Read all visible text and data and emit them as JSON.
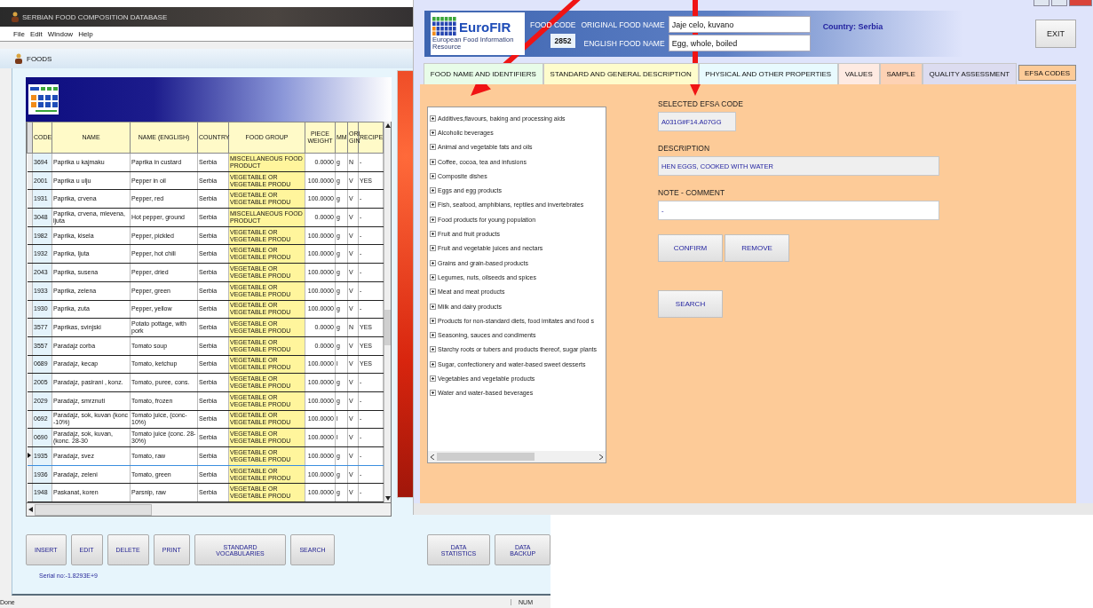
{
  "main_window": {
    "title": "SERBIAN FOOD COMPOSITION DATABASE",
    "menu": [
      "File",
      "Edit",
      "Window",
      "Help"
    ],
    "child_window": {
      "title": "FOODS"
    },
    "table": {
      "columns": [
        "CODE",
        "NAME",
        "NAME (ENGLISH)",
        "COUNTRY",
        "FOOD GROUP",
        "PIECE WEIGHT",
        "MM",
        "ORI GIN",
        "RECIPE"
      ],
      "rows": [
        {
          "selected": false,
          "cells": [
            "3694",
            "Paprika u kajmaku",
            "Paprika in custard",
            "Serbia",
            "MISCELLANEOUS FOOD PRODUCT",
            "0.0000",
            "g",
            "N",
            "-"
          ]
        },
        {
          "selected": false,
          "cells": [
            "2001",
            "Paprika u ulju",
            "Pepper in oil",
            "Serbia",
            "VEGETABLE OR VEGETABLE PRODU",
            "100.0000",
            "g",
            "V",
            "YES"
          ]
        },
        {
          "selected": false,
          "cells": [
            "1931",
            "Paprika, crvena",
            "Pepper, red",
            "Serbia",
            "VEGETABLE OR VEGETABLE PRODU",
            "100.0000",
            "g",
            "V",
            "-"
          ]
        },
        {
          "selected": false,
          "cells": [
            "3048",
            "Paprika, crvena, mlevena, ljuta",
            "Hot pepper, ground",
            "Serbia",
            "MISCELLANEOUS FOOD PRODUCT",
            "0.0000",
            "g",
            "V",
            "-"
          ]
        },
        {
          "selected": false,
          "cells": [
            "1982",
            "Paprika, kisela",
            "Pepper, pickled",
            "Serbia",
            "VEGETABLE OR VEGETABLE PRODU",
            "100.0000",
            "g",
            "V",
            "-"
          ]
        },
        {
          "selected": false,
          "cells": [
            "1932",
            "Paprika, ljuta",
            "Pepper, hot chili",
            "Serbia",
            "VEGETABLE OR VEGETABLE PRODU",
            "100.0000",
            "g",
            "V",
            "-"
          ]
        },
        {
          "selected": false,
          "cells": [
            "2043",
            "Paprika, susena",
            "Pepper, dried",
            "Serbia",
            "VEGETABLE OR VEGETABLE PRODU",
            "100.0000",
            "g",
            "V",
            "-"
          ]
        },
        {
          "selected": false,
          "cells": [
            "1933",
            "Paprika, zelena",
            "Pepper, green",
            "Serbia",
            "VEGETABLE OR VEGETABLE PRODU",
            "100.0000",
            "g",
            "V",
            "-"
          ]
        },
        {
          "selected": false,
          "cells": [
            "1930",
            "Paprika, zuta",
            "Pepper, yellow",
            "Serbia",
            "VEGETABLE OR VEGETABLE PRODU",
            "100.0000",
            "g",
            "V",
            "-"
          ]
        },
        {
          "selected": false,
          "cells": [
            "3577",
            "Paprikas, svinjski",
            "Potato pottage, with pork",
            "Serbia",
            "VEGETABLE OR VEGETABLE PRODU",
            "0.0000",
            "g",
            "N",
            "YES"
          ]
        },
        {
          "selected": false,
          "cells": [
            "3557",
            "Paradajz corba",
            "Tomato soup",
            "Serbia",
            "VEGETABLE OR VEGETABLE PRODU",
            "0.0000",
            "g",
            "V",
            "YES"
          ]
        },
        {
          "selected": false,
          "cells": [
            "0689",
            "Paradajz, kecap",
            "Tomato, ketchup",
            "Serbia",
            "VEGETABLE OR VEGETABLE PRODU",
            "100.0000",
            "l",
            "V",
            "YES"
          ]
        },
        {
          "selected": false,
          "cells": [
            "2005",
            "Paradajz, pasirani , konz.",
            "Tomato, puree, cons.",
            "Serbia",
            "VEGETABLE OR VEGETABLE PRODU",
            "100.0000",
            "g",
            "V",
            "-"
          ]
        },
        {
          "selected": false,
          "cells": [
            "2029",
            "Paradajz, smrznuti",
            "Tomato, frozen",
            "Serbia",
            "VEGETABLE OR VEGETABLE PRODU",
            "100.0000",
            "g",
            "V",
            "-"
          ]
        },
        {
          "selected": false,
          "cells": [
            "0692",
            "Paradajz, sok, kuvan (konc -10%)",
            "Tomato juice, (conc-10%)",
            "Serbia",
            "VEGETABLE OR VEGETABLE PRODU",
            "100.0000",
            "l",
            "V",
            "-"
          ]
        },
        {
          "selected": false,
          "cells": [
            "0690",
            "Paradajz, sok, kuvan, (konc. 28-30",
            "Tomato juice (conc. 28-30%)",
            "Serbia",
            "VEGETABLE OR VEGETABLE PRODU",
            "100.0000",
            "l",
            "V",
            "-"
          ]
        },
        {
          "selected": true,
          "cells": [
            "1935",
            "Paradajz, svez",
            "Tomato, raw",
            "Serbia",
            "VEGETABLE OR VEGETABLE PRODU",
            "100.0000",
            "g",
            "V",
            "-"
          ]
        },
        {
          "selected": false,
          "cells": [
            "1936",
            "Paradajz, zeleni",
            "Tomato, green",
            "Serbia",
            "VEGETABLE OR VEGETABLE PRODU",
            "100.0000",
            "g",
            "V",
            "-"
          ]
        },
        {
          "selected": false,
          "cells": [
            "1948",
            "Paskanat, koren",
            "Parsnip, raw",
            "Serbia",
            "VEGETABLE OR VEGETABLE PRODU",
            "100.0000",
            "g",
            "V",
            "-"
          ]
        }
      ]
    },
    "buttons": [
      "INSERT",
      "EDIT",
      "DELETE",
      "PRINT",
      "STANDARD VOCABULARIES",
      "SEARCH"
    ],
    "side_buttons": [
      "DATA STATISTICS",
      "DATA BACKUP"
    ],
    "serial": "Serial no:-1.8293E+9",
    "status_bar": {
      "text": "Done",
      "indicator": "NUM"
    }
  },
  "properties_window": {
    "logo": {
      "name": "EuroFIR",
      "tagline": "European Food Information Resource"
    },
    "food_code_label": "FOOD CODE",
    "food_code": "2852",
    "original_name_label": "ORIGINAL FOOD NAME",
    "original_name": "Jaje celo, kuvano",
    "english_name_label": "ENGLISH FOOD NAME",
    "english_name": "Egg, whole, boiled",
    "country": "Country: Serbia",
    "exit": "EXIT",
    "tabs": [
      {
        "label": "FOOD NAME AND IDENTIFIERS",
        "color": "#e8fce8",
        "selected": false
      },
      {
        "label": "STANDARD AND GENERAL  DESCRIPTION",
        "color": "#fefccc",
        "selected": false
      },
      {
        "label": "PHYSICAL AND OTHER PROPERTIES",
        "color": "#e8fafe",
        "selected": false
      },
      {
        "label": "VALUES",
        "color": "#feeae2",
        "selected": false
      },
      {
        "label": "SAMPLE",
        "color": "#fdd2b4",
        "selected": false
      },
      {
        "label": "QUALITY ASSESSMENT",
        "color": "#dcdcf0",
        "selected": false
      },
      {
        "label": "EFSA CODES",
        "color": "#fdcb98",
        "selected": true
      }
    ],
    "tree": [
      {
        "label": "Additives,flavours, baking and processing aids",
        "expanded": false
      },
      {
        "label": "Alcoholic beverages",
        "expanded": false
      },
      {
        "label": "Animal and vegetable fats and oils",
        "expanded": false
      },
      {
        "label": "Coffee, cocoa, tea and infusions",
        "expanded": false
      },
      {
        "label": "Composite dishes",
        "expanded": false
      },
      {
        "label": "Eggs and egg products",
        "expanded": false
      },
      {
        "label": "Fish, seafood, amphibians, reptiles and invertebrates",
        "expanded": false
      },
      {
        "label": "Food products for young population",
        "expanded": false
      },
      {
        "label": "Fruit and fruit products",
        "expanded": false
      },
      {
        "label": "Fruit and vegetable juices and nectars",
        "expanded": false
      },
      {
        "label": "Grains and grain-based products",
        "expanded": false
      },
      {
        "label": "Legumes, nuts, oilseeds and spices",
        "expanded": false
      },
      {
        "label": "Meat and meat products",
        "expanded": false
      },
      {
        "label": "Milk and dairy products",
        "expanded": false
      },
      {
        "label": "Products for non-standard diets, food imitates and food s",
        "expanded": false
      },
      {
        "label": "Seasoning, sauces and condiments",
        "expanded": false
      },
      {
        "label": "Starchy roots or tubers and products thereof, sugar plants",
        "expanded": false
      },
      {
        "label": "Sugar, confectionery and water-based sweet desserts",
        "expanded": false
      },
      {
        "label": "Vegetables and vegetable products",
        "expanded": false
      },
      {
        "label": "Water and water-based beverages",
        "expanded": false
      }
    ],
    "selected_code": {
      "label": "SELECTED EFSA CODE",
      "value": "A031G#F14.A07GG"
    },
    "description": {
      "label": "DESCRIPTION",
      "value": "HEN EGGS, COOKED WITH WATER"
    },
    "note": {
      "label": "NOTE - COMMENT",
      "value": "-"
    },
    "buttons": [
      "CONFIRM",
      "REMOVE"
    ],
    "search_button": "SEARCH"
  }
}
